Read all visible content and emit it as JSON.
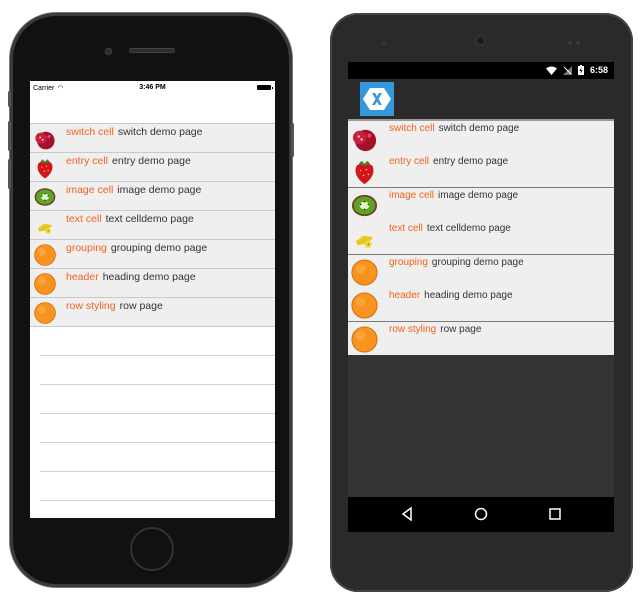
{
  "ios": {
    "status": {
      "carrier": "Carrier",
      "time": "3:46 PM"
    },
    "rows": [
      {
        "title": "switch cell",
        "detail": "switch demo page",
        "icon": "pomegranate-icon"
      },
      {
        "title": "entry cell",
        "detail": "entry demo page",
        "icon": "strawberry-icon"
      },
      {
        "title": "image cell",
        "detail": "image demo page",
        "icon": "kiwi-icon"
      },
      {
        "title": "text cell",
        "detail": "text celldemo page",
        "icon": "starfruit-icon"
      },
      {
        "title": "grouping",
        "detail": "grouping demo page",
        "icon": "orange-icon"
      },
      {
        "title": "header",
        "detail": "heading demo page",
        "icon": "orange-icon"
      },
      {
        "title": "row styling",
        "detail": "row page",
        "icon": "orange-icon"
      }
    ]
  },
  "android": {
    "status": {
      "time": "6:58"
    },
    "rows": [
      {
        "title": "switch cell",
        "detail": "switch demo page",
        "icon": "pomegranate-icon"
      },
      {
        "title": "entry cell",
        "detail": "entry demo page",
        "icon": "strawberry-icon"
      },
      {
        "title": "image cell",
        "detail": "image demo page",
        "icon": "kiwi-icon"
      },
      {
        "title": "text cell",
        "detail": "text celldemo page",
        "icon": "starfruit-icon"
      },
      {
        "title": "grouping",
        "detail": "grouping demo page",
        "icon": "orange-icon"
      },
      {
        "title": "header",
        "detail": "heading demo page",
        "icon": "orange-icon"
      },
      {
        "title": "row styling",
        "detail": "row page",
        "icon": "orange-icon"
      }
    ]
  },
  "colors": {
    "title": "#f0621e",
    "detail": "#333333",
    "list_bg": "#efefef",
    "logo": "#3498db"
  }
}
